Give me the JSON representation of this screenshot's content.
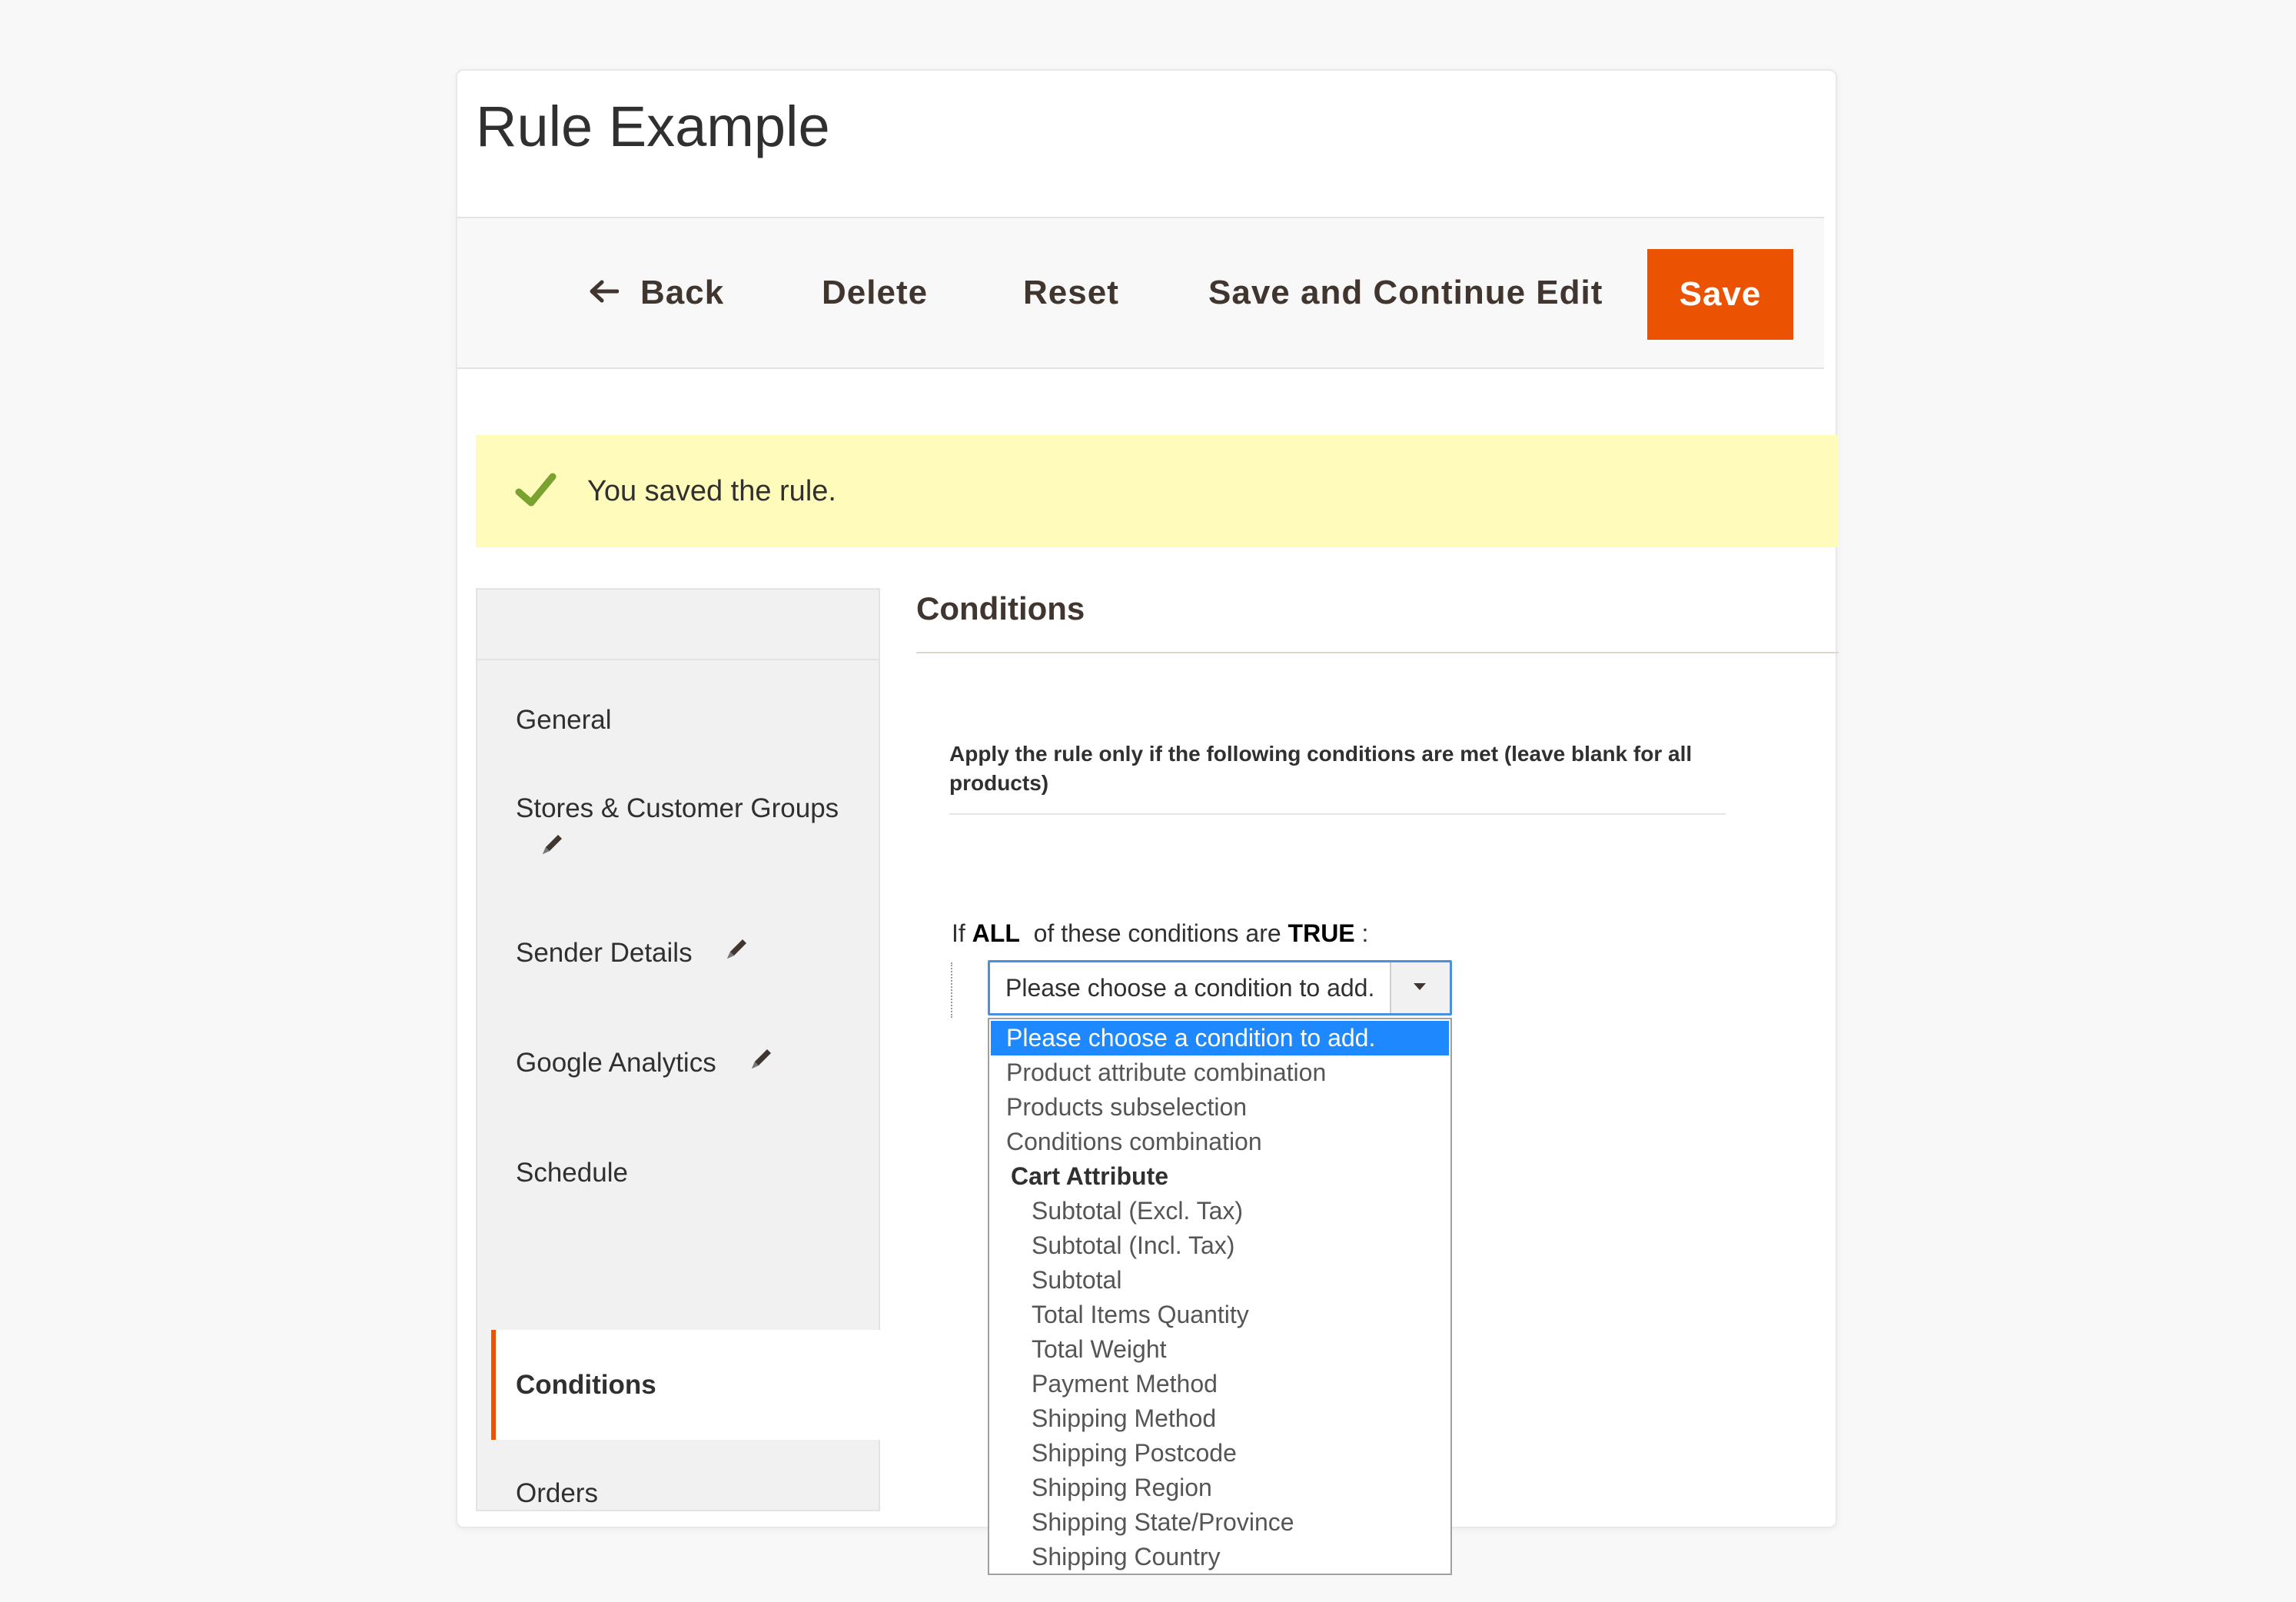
{
  "page": {
    "title": "Rule Example"
  },
  "toolbar": {
    "back": "Back",
    "delete": "Delete",
    "reset": "Reset",
    "save_continue": "Save and Continue Edit",
    "save": "Save"
  },
  "message": {
    "text": "You saved the rule."
  },
  "tabs": [
    {
      "label": "General",
      "edited": false
    },
    {
      "label": "Stores & Customer Groups",
      "edited": true
    },
    {
      "label": "Sender Details",
      "edited": true
    },
    {
      "label": "Google Analytics",
      "edited": true
    },
    {
      "label": "Schedule",
      "edited": false
    },
    {
      "label": "Conditions",
      "edited": false,
      "active": true
    },
    {
      "label": "Orders",
      "edited": false
    }
  ],
  "conditions": {
    "section_title": "Conditions",
    "apply_text": "Apply the rule only if the following conditions are met (leave blank for all products)",
    "if_prefix": "If",
    "aggregator": "ALL",
    "mid": "of these conditions are",
    "value": "TRUE",
    "suffix": ":",
    "select_value": "Please choose a condition to add.",
    "options": [
      {
        "label": "Please choose a condition to add.",
        "type": "selected"
      },
      {
        "label": "Product attribute combination",
        "type": "option"
      },
      {
        "label": "Products subselection",
        "type": "option"
      },
      {
        "label": "Conditions combination",
        "type": "option"
      },
      {
        "label": "Cart Attribute",
        "type": "group"
      },
      {
        "label": "Subtotal (Excl. Tax)",
        "type": "sub"
      },
      {
        "label": "Subtotal (Incl. Tax)",
        "type": "sub"
      },
      {
        "label": "Subtotal",
        "type": "sub"
      },
      {
        "label": "Total Items Quantity",
        "type": "sub"
      },
      {
        "label": "Total Weight",
        "type": "sub"
      },
      {
        "label": "Payment Method",
        "type": "sub"
      },
      {
        "label": "Shipping Method",
        "type": "sub"
      },
      {
        "label": "Shipping Postcode",
        "type": "sub"
      },
      {
        "label": "Shipping Region",
        "type": "sub"
      },
      {
        "label": "Shipping State/Province",
        "type": "sub"
      },
      {
        "label": "Shipping Country",
        "type": "sub"
      }
    ]
  },
  "colors": {
    "accent": "#eb5202",
    "message_bg": "#fffbbb",
    "selected_option": "#1e88ff",
    "success_check": "#79a22e"
  }
}
